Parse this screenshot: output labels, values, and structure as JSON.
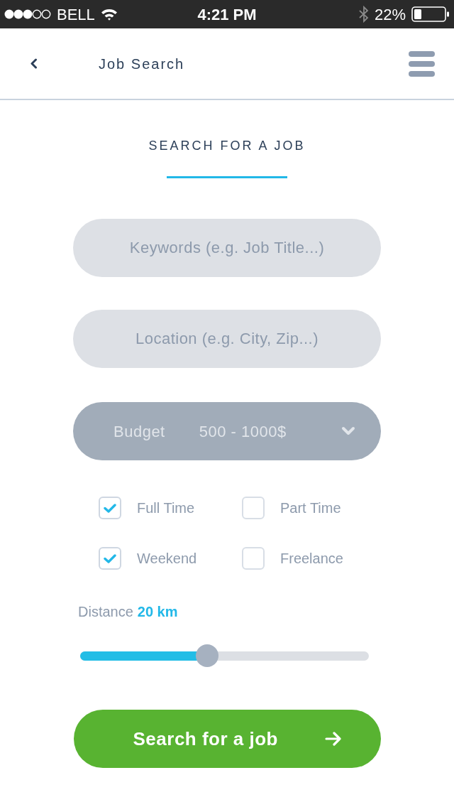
{
  "status_bar": {
    "carrier": "BELL",
    "time": "4:21 PM",
    "battery": "22%"
  },
  "nav": {
    "title": "Job Search"
  },
  "heading": "SEARCH FOR A JOB",
  "fields": [
    {
      "placeholder": "Keywords (e.g. Job Title...)"
    },
    {
      "placeholder": "Location (e.g. City, Zip...)"
    }
  ],
  "budget": {
    "label": "Budget",
    "value": "500 - 1000$"
  },
  "job_types": [
    {
      "label": "Full Time",
      "checked": true
    },
    {
      "label": "Part Time",
      "checked": false
    },
    {
      "label": "Weekend",
      "checked": true
    },
    {
      "label": "Freelance",
      "checked": false
    }
  ],
  "distance": {
    "label": "Distance",
    "value": "20 km",
    "level": 0.44
  },
  "search_button": {
    "label": "Search for a job"
  }
}
